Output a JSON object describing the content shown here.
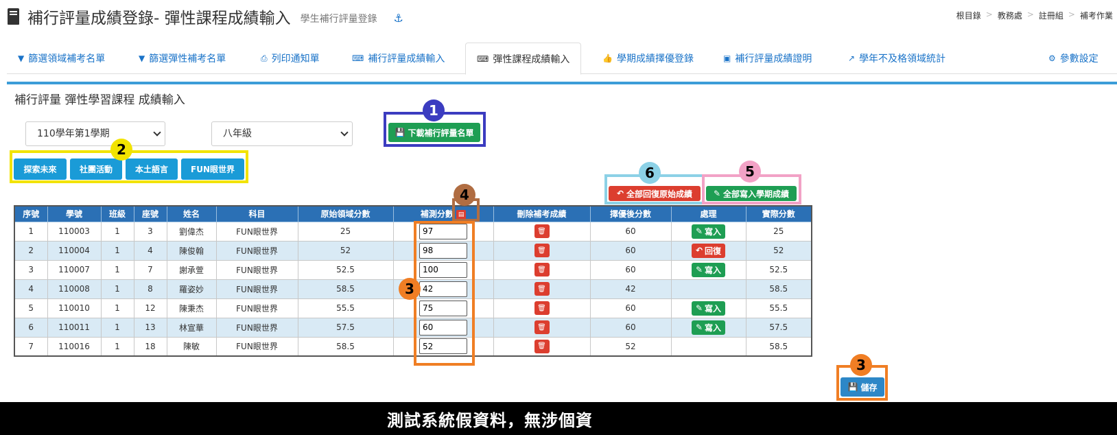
{
  "header": {
    "title": "補行評量成績登錄- 彈性課程成績輸入",
    "subtitle": "學生補行評量登錄",
    "icon": "book-icon",
    "anchor_icon": "anchor-icon"
  },
  "breadcrumbs": [
    "根目錄",
    "教務處",
    "註冊組",
    "補考作業"
  ],
  "tabs": [
    {
      "label": "篩選領域補考名單",
      "icon": "filter-icon"
    },
    {
      "label": "篩選彈性補考名單",
      "icon": "filter-icon"
    },
    {
      "label": "列印通知單",
      "icon": "print-icon"
    },
    {
      "label": "補行評量成績輸入",
      "icon": "keyboard-icon"
    },
    {
      "label": "彈性課程成績輸入",
      "icon": "keyboard-icon"
    },
    {
      "label": "學期成績擇優登錄",
      "icon": "thumbs-up-icon"
    },
    {
      "label": "補行評量成績證明",
      "icon": "id-card-icon"
    },
    {
      "label": "學年不及格領域統計",
      "icon": "line-chart-icon"
    },
    {
      "label": "參數設定",
      "icon": "gear-icon"
    }
  ],
  "panel": {
    "title": "補行評量 彈性學習課程 成績輸入",
    "semester": "110學年第1學期",
    "grade": "八年級",
    "download_label": "下載補行評量名單",
    "courses": [
      "探索未來",
      "社團活動",
      "本土語言",
      "FUN眼世界"
    ],
    "restore_all_label": "全部回復原始成績",
    "write_all_label": "全部寫入學期成績",
    "save_label": "儲存"
  },
  "table": {
    "headers": [
      "序號",
      "學號",
      "班級",
      "座號",
      "姓名",
      "科目",
      "原始領域分數",
      "補測分數",
      "刪除補考成績",
      "擇優後分數",
      "處理",
      "實際分數"
    ],
    "rows": [
      {
        "no": "1",
        "id": "110003",
        "cls": "1",
        "seat": "3",
        "name": "劉偉杰",
        "subject": "FUN眼世界",
        "orig": "25",
        "retest": "97",
        "best": "60",
        "action": "寫入",
        "actual": "25"
      },
      {
        "no": "2",
        "id": "110004",
        "cls": "1",
        "seat": "4",
        "name": "陳俊翰",
        "subject": "FUN眼世界",
        "orig": "52",
        "retest": "98",
        "best": "60",
        "action": "回復",
        "actual": "52"
      },
      {
        "no": "3",
        "id": "110007",
        "cls": "1",
        "seat": "7",
        "name": "謝承萱",
        "subject": "FUN眼世界",
        "orig": "52.5",
        "retest": "100",
        "best": "60",
        "action": "寫入",
        "actual": "52.5"
      },
      {
        "no": "4",
        "id": "110008",
        "cls": "1",
        "seat": "8",
        "name": "羅姿妙",
        "subject": "FUN眼世界",
        "orig": "58.5",
        "retest": "42",
        "best": "42",
        "action": "",
        "actual": "58.5"
      },
      {
        "no": "5",
        "id": "110010",
        "cls": "1",
        "seat": "12",
        "name": "陳秉杰",
        "subject": "FUN眼世界",
        "orig": "55.5",
        "retest": "75",
        "best": "60",
        "action": "寫入",
        "actual": "55.5"
      },
      {
        "no": "6",
        "id": "110011",
        "cls": "1",
        "seat": "13",
        "name": "林宣華",
        "subject": "FUN眼世界",
        "orig": "57.5",
        "retest": "60",
        "best": "60",
        "action": "寫入",
        "actual": "57.5"
      },
      {
        "no": "7",
        "id": "110016",
        "cls": "1",
        "seat": "18",
        "name": "陳敏",
        "subject": "FUN眼世界",
        "orig": "58.5",
        "retest": "52",
        "best": "52",
        "action": "",
        "actual": "58.5"
      }
    ]
  },
  "annotations": {
    "n1": "1",
    "n2": "2",
    "n3a": "3",
    "n3b": "3",
    "n4": "4",
    "n5": "5",
    "n6": "6",
    "colors": {
      "blue": "#3b3cc0",
      "yellow": "#f2e300",
      "orange": "#f07e24",
      "brown": "#b06d42",
      "pink": "#f2a2c6",
      "cyan": "#8cd1e6"
    }
  },
  "footer": "測試系統假資料，無涉個資"
}
